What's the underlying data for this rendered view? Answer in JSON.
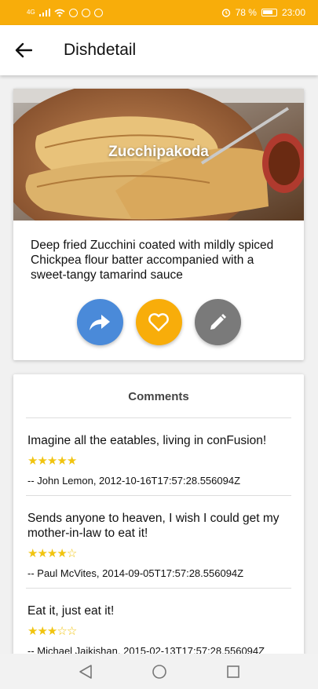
{
  "status_bar": {
    "battery_percent": "78 %",
    "time": "23:00",
    "network": "4G"
  },
  "app_bar": {
    "title": "Dishdetail"
  },
  "dish": {
    "name": "Zucchipakoda",
    "description": "Deep fried Zucchini coated with mildly spiced Chickpea flour batter accompanied with a sweet-tangy tamarind sauce",
    "actions": [
      {
        "name": "share",
        "color": "#4a8ad9",
        "icon": "share-icon"
      },
      {
        "name": "favorite",
        "color": "#f8ad0a",
        "icon": "heart-icon"
      },
      {
        "name": "edit",
        "color": "#7a7a7a",
        "icon": "pencil-icon"
      }
    ]
  },
  "comments": {
    "title": "Comments",
    "items": [
      {
        "text": "Imagine all the eatables, living in conFusion!",
        "rating": 5,
        "author": "-- John Lemon, 2012-10-16T17:57:28.556094Z"
      },
      {
        "text": "Sends anyone to heaven, I wish I could get my mother-in-law to eat it!",
        "rating": 4,
        "author": "-- Paul McVites, 2014-09-05T17:57:28.556094Z"
      },
      {
        "text": "Eat it, just eat it!",
        "rating": 3,
        "author": "-- Michael Jaikishan, 2015-02-13T17:57:28.556094Z"
      }
    ]
  }
}
